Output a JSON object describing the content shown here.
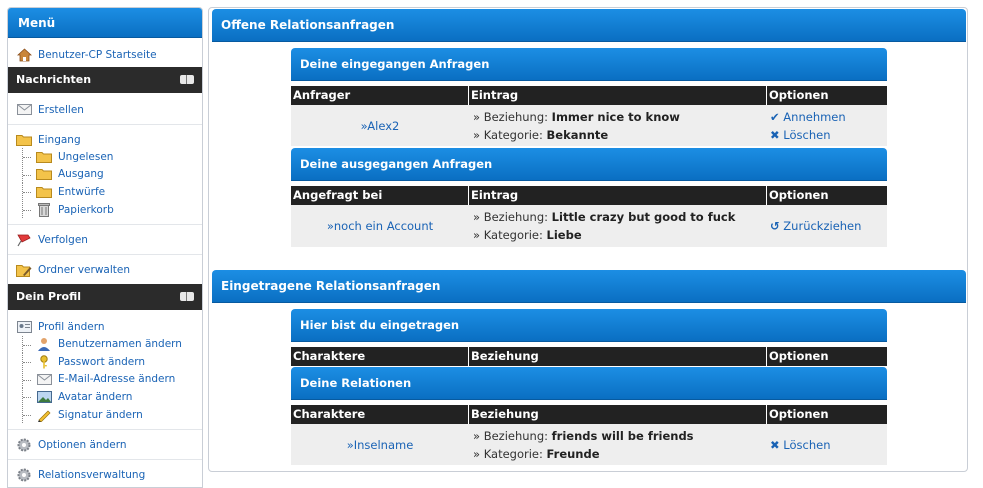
{
  "sidebar": {
    "title": "Menü",
    "startseite": "Benutzer-CP Startseite",
    "sections": {
      "nachrichten": "Nachrichten",
      "profil": "Dein Profil"
    },
    "nachrichten": {
      "erstellen": "Erstellen",
      "eingang": "Eingang",
      "ungelesen": "Ungelesen",
      "ausgang": "Ausgang",
      "entwuerfe": "Entwürfe",
      "papierkorb": "Papierkorb",
      "verfolgen": "Verfolgen",
      "ordner": "Ordner verwalten"
    },
    "profil": {
      "profil_aendern": "Profil ändern",
      "benutzername": "Benutzernamen ändern",
      "passwort": "Passwort ändern",
      "email": "E-Mail-Adresse ändern",
      "avatar": "Avatar ändern",
      "signatur": "Signatur ändern",
      "optionen": "Optionen ändern",
      "relationen": "Relationsverwaltung"
    }
  },
  "main": {
    "offene_title": "Offene Relationsanfragen",
    "eingegangen": {
      "title": "Deine eingegangen Anfragen",
      "columns": [
        "Anfrager",
        "Eintrag",
        "Optionen"
      ],
      "row": {
        "name": "»Alex2",
        "beziehung_label": "» Beziehung:",
        "beziehung": "Immer nice to know",
        "kategorie_label": "» Kategorie:",
        "kategorie": "Bekannte",
        "accept": "Annehmen",
        "delete": "Löschen"
      }
    },
    "ausgegangen": {
      "title": "Deine ausgegangen Anfragen",
      "columns": [
        "Angefragt bei",
        "Eintrag",
        "Optionen"
      ],
      "row": {
        "name": "»noch ein Account",
        "beziehung_label": "» Beziehung:",
        "beziehung": "Little crazy but good to fuck",
        "kategorie_label": "» Kategorie:",
        "kategorie": "Liebe",
        "withdraw": "Zurückziehen"
      }
    },
    "eingetragene_title": "Eingetragene Relationsanfragen",
    "eingetragen": {
      "title": "Hier bist du eingetragen",
      "columns": [
        "Charaktere",
        "Beziehung",
        "Optionen"
      ]
    },
    "relationen": {
      "title": "Deine Relationen",
      "columns": [
        "Charaktere",
        "Beziehung",
        "Optionen"
      ],
      "row": {
        "name": "»Inselname",
        "beziehung_label": "» Beziehung:",
        "beziehung": "friends will be friends",
        "kategorie_label": "» Kategorie:",
        "kategorie": "Freunde",
        "delete": "Löschen"
      }
    }
  },
  "colors": {
    "accent": "#0a6fc2",
    "link": "#1a63b5",
    "header_dark": "#222222",
    "row_bg": "#eeeeee"
  }
}
